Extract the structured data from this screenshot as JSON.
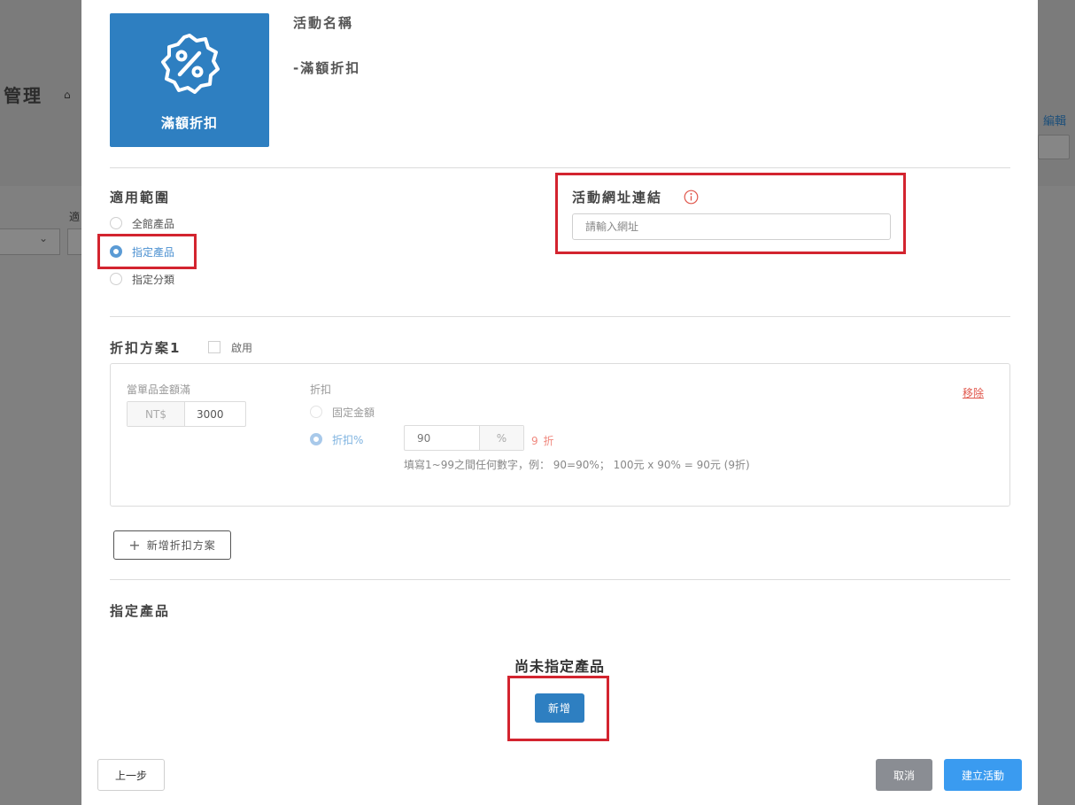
{
  "background": {
    "page_title": "管理",
    "home_icon": "home-icon",
    "edit_link": "編輯",
    "filter_label": "適"
  },
  "activity": {
    "badge_icon": "percent-badge-icon",
    "badge_label": "滿額折扣",
    "name_label": "活動名稱",
    "name_value": "-滿額折扣"
  },
  "scope": {
    "title": "適用範圍",
    "options": [
      "全館產品",
      "指定產品",
      "指定分類"
    ],
    "selected": "指定產品"
  },
  "url_link": {
    "title": "活動網址連結",
    "info_icon": "info-icon",
    "placeholder": "請輸入網址"
  },
  "plan": {
    "title": "折扣方案1",
    "enable_label": "啟用",
    "min_amount_label": "當單品金額滿",
    "currency": "NT$",
    "min_amount_value": "3000",
    "discount_label": "折扣",
    "discount_options": [
      "固定金額",
      "折扣%"
    ],
    "discount_selected": "折扣%",
    "percent_value": "90",
    "percent_unit": "%",
    "fold_text": "9 折",
    "hint": "填寫1~99之間任何數字，例： 90=90%； 100元 x 90% = 90元 (9折)",
    "remove_label": "移除"
  },
  "add_plan_label": "新增折扣方案",
  "products": {
    "title": "指定產品",
    "empty_text": "尚未指定產品",
    "add_label": "新增"
  },
  "footer": {
    "prev_label": "上一步",
    "cancel_label": "取消",
    "create_label": "建立活動"
  },
  "colors": {
    "primary": "#2e7fc1",
    "highlight_box": "#d3242f",
    "create_button": "#3a9bf0",
    "cancel_button": "#8a8d93"
  }
}
